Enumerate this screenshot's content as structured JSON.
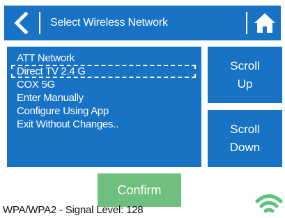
{
  "header": {
    "title": "Select Wireless Network",
    "back_icon": "chevron-left-icon",
    "home_icon": "home-icon",
    "background_color": "#1873c4"
  },
  "network_list": {
    "items": [
      {
        "label": "ATT Network",
        "selected": false
      },
      {
        "label": "Direct TV 2.4 G",
        "selected": true
      },
      {
        "label": "COX 5G",
        "selected": false
      },
      {
        "label": "Enter Manually",
        "selected": false
      },
      {
        "label": "Configure Using App",
        "selected": false
      },
      {
        "label": "Exit Without Changes..",
        "selected": false
      }
    ]
  },
  "scroll_up": {
    "line1": "Scroll",
    "line2": "Up"
  },
  "scroll_down": {
    "line1": "Scroll",
    "line2": "Down"
  },
  "confirm": {
    "label": "Confirm",
    "color": "#6fbf7e"
  },
  "status": {
    "text": "WPA/WPA2 - Signal Level: 128"
  },
  "wifi_icon": {
    "name": "wifi-signal-icon",
    "color": "#5cc47a"
  }
}
